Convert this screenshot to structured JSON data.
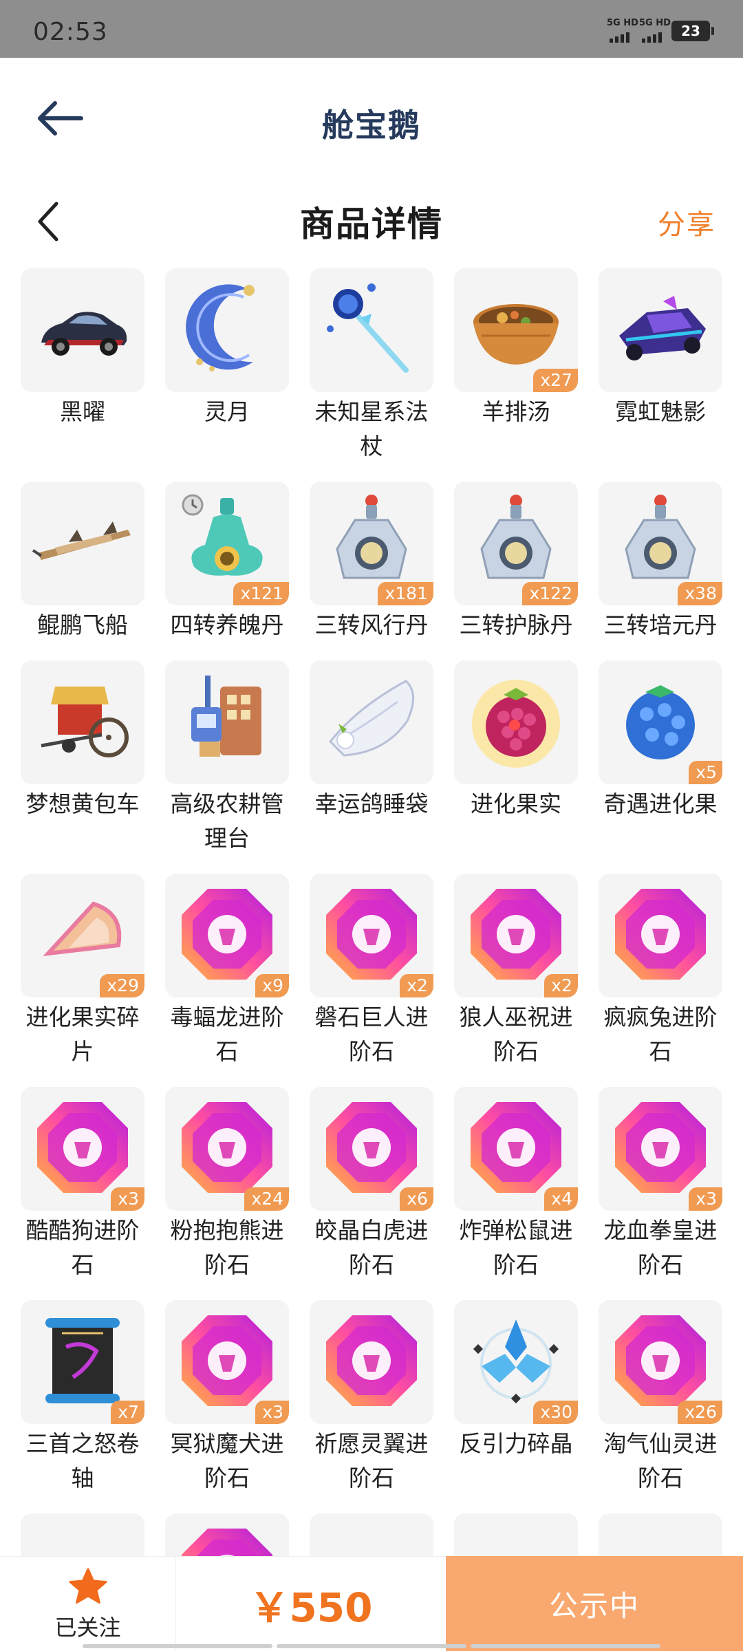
{
  "status_bar": {
    "time": "02:53",
    "signal1": "5G HD",
    "signal2": "5G HD",
    "battery": "23"
  },
  "header": {
    "app_title": "舱宝鹅"
  },
  "subheader": {
    "title": "商品详情",
    "share": "分享"
  },
  "items": [
    {
      "name": "黑曜",
      "qty": "",
      "icon": "car-icon"
    },
    {
      "name": "灵月",
      "qty": "",
      "icon": "moon-wing-icon"
    },
    {
      "name": "未知星系法杖",
      "qty": "",
      "icon": "staff-icon"
    },
    {
      "name": "羊排汤",
      "qty": "x27",
      "icon": "soup-bowl-icon"
    },
    {
      "name": "霓虹魅影",
      "qty": "",
      "icon": "kart-icon"
    },
    {
      "name": "鲲鹏飞船",
      "qty": "",
      "icon": "airship-icon"
    },
    {
      "name": "四转养魄丹",
      "qty": "x121",
      "icon": "potion-flask-icon"
    },
    {
      "name": "三转风行丹",
      "qty": "x181",
      "icon": "potion-bottle-icon"
    },
    {
      "name": "三转护脉丹",
      "qty": "x122",
      "icon": "potion-bottle-icon"
    },
    {
      "name": "三转培元丹",
      "qty": "x38",
      "icon": "potion-bottle-icon"
    },
    {
      "name": "梦想黄包车",
      "qty": "",
      "icon": "rickshaw-icon"
    },
    {
      "name": "高级农耕管理台",
      "qty": "",
      "icon": "farm-console-icon"
    },
    {
      "name": "幸运鸽睡袋",
      "qty": "",
      "icon": "pigeon-sleeping-bag-icon"
    },
    {
      "name": "进化果实",
      "qty": "",
      "icon": "raspberry-icon"
    },
    {
      "name": "奇遇进化果",
      "qty": "x5",
      "icon": "blue-berry-icon"
    },
    {
      "name": "进化果实碎片",
      "qty": "x29",
      "icon": "fruit-shard-icon"
    },
    {
      "name": "毒蝠龙进阶石",
      "qty": "x9",
      "icon": "evolution-gem-icon"
    },
    {
      "name": "磐石巨人进阶石",
      "qty": "x2",
      "icon": "evolution-gem-icon"
    },
    {
      "name": "狼人巫祝进阶石",
      "qty": "x2",
      "icon": "evolution-gem-icon"
    },
    {
      "name": "疯疯兔进阶石",
      "qty": "",
      "icon": "evolution-gem-icon"
    },
    {
      "name": "酷酷狗进阶石",
      "qty": "x3",
      "icon": "evolution-gem-icon"
    },
    {
      "name": "粉抱抱熊进阶石",
      "qty": "x24",
      "icon": "evolution-gem-icon"
    },
    {
      "name": "皎晶白虎进阶石",
      "qty": "x6",
      "icon": "evolution-gem-icon"
    },
    {
      "name": "炸弹松鼠进阶石",
      "qty": "x4",
      "icon": "evolution-gem-icon"
    },
    {
      "name": "龙血拳皇进阶石",
      "qty": "x3",
      "icon": "evolution-gem-icon"
    },
    {
      "name": "三首之怒卷轴",
      "qty": "x7",
      "icon": "scroll-icon"
    },
    {
      "name": "冥狱魔犬进阶石",
      "qty": "x3",
      "icon": "evolution-gem-icon"
    },
    {
      "name": "祈愿灵翼进阶石",
      "qty": "",
      "icon": "evolution-gem-icon"
    },
    {
      "name": "反引力碎晶",
      "qty": "x30",
      "icon": "crystal-emblem-icon"
    },
    {
      "name": "淘气仙灵进阶石",
      "qty": "x26",
      "icon": "evolution-gem-icon"
    },
    {
      "name": "",
      "qty": "",
      "icon": "gold-item-icon"
    },
    {
      "name": "",
      "qty": "",
      "icon": "evolution-gem-icon"
    },
    {
      "name": "",
      "qty": "",
      "icon": "dark-item-icon"
    },
    {
      "name": "",
      "qty": "",
      "icon": "cat-figure-icon"
    },
    {
      "name": "",
      "qty": "",
      "icon": "pink-creature-icon"
    }
  ],
  "bottom_bar": {
    "follow_label": "已关注",
    "price": "￥550",
    "status": "公示中"
  },
  "colors": {
    "accent": "#f07f2a",
    "gem_start": "#ff9a3c",
    "gem_end": "#c21fd6",
    "button": "#f9a86f"
  }
}
